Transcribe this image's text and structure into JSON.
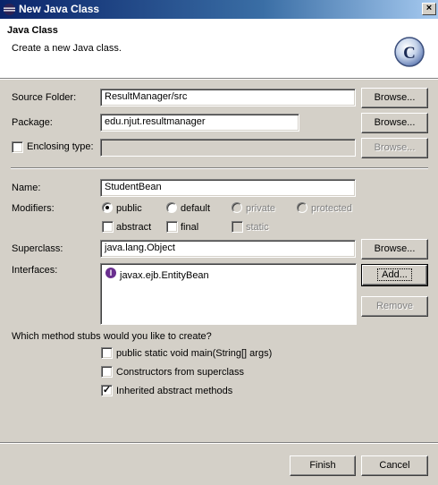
{
  "window": {
    "title": "New Java Class",
    "close_glyph": "×"
  },
  "banner": {
    "title": "Java Class",
    "description": "Create a new Java class.",
    "icon_letter": "C"
  },
  "form": {
    "source_folder": {
      "label": "Source Folder:",
      "value": "ResultManager/src",
      "button": "Browse..."
    },
    "package": {
      "label": "Package:",
      "value": "edu.njut.resultmanager",
      "button": "Browse..."
    },
    "enclosing_type": {
      "label": "Enclosing type:",
      "value": "",
      "button": "Browse...",
      "checked": false
    },
    "name": {
      "label": "Name:",
      "value": "StudentBean"
    },
    "modifiers": {
      "label": "Modifiers:",
      "public": "public",
      "default": "default",
      "private": "private",
      "protected": "protected",
      "abstract": "abstract",
      "final": "final",
      "static": "static",
      "selected": "public"
    },
    "superclass": {
      "label": "Superclass:",
      "value": "java.lang.Object",
      "button": "Browse..."
    },
    "interfaces": {
      "label": "Interfaces:",
      "items": [
        "javax.ejb.EntityBean"
      ],
      "add_button": "Add...",
      "remove_button": "Remove",
      "item_icon_letter": "I"
    },
    "stubs": {
      "question": "Which method stubs would you like to create?",
      "main": {
        "label": "public static void main(String[] args)",
        "checked": false
      },
      "constructors": {
        "label": "Constructors from superclass",
        "checked": false
      },
      "inherited": {
        "label": "Inherited abstract methods",
        "checked": true
      },
      "check_glyph": "✓"
    }
  },
  "footer": {
    "finish": "Finish",
    "cancel": "Cancel"
  },
  "colors": {
    "titlebar_start": "#0a246a",
    "titlebar_end": "#a6caf0",
    "dialog_bg": "#d4d0c8",
    "interface_icon": "#6a2f8f"
  },
  "icons": {
    "window": "eclipse-icon",
    "banner": "class-wizard-icon",
    "interface": "interface-icon",
    "close": "close-icon"
  }
}
